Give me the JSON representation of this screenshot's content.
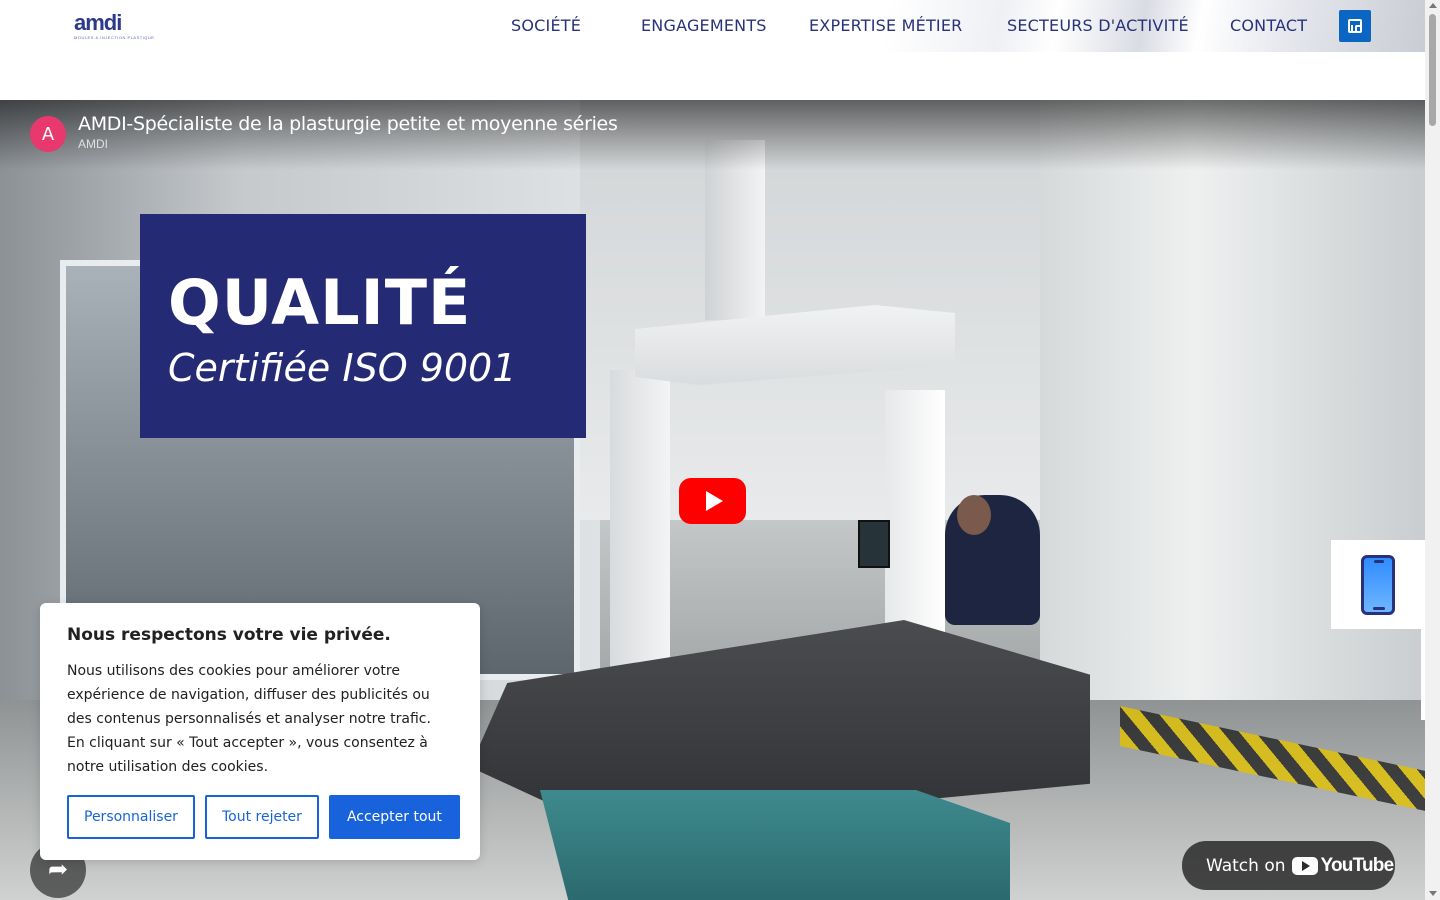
{
  "header": {
    "logo": {
      "wordmark": "amdi",
      "tagline": "MOULES & INJECTION PLASTIQUE"
    },
    "nav": [
      {
        "label": "SOCIÉTÉ"
      },
      {
        "label": "ENGAGEMENTS"
      },
      {
        "label": "EXPERTISE MÉTIER"
      },
      {
        "label": "SECTEURS D'ACTIVITÉ"
      },
      {
        "label": "CONTACT"
      }
    ],
    "social_icon": "linkedin-icon",
    "colors": {
      "nav_text": "#27327a",
      "linkedin_bg": "#0a66c2"
    }
  },
  "video": {
    "channel_initial": "A",
    "title": "AMDI-Spécialiste de la plasturgie petite et moyenne séries",
    "channel": "AMDI",
    "overlay": {
      "headline": "QUALITÉ",
      "subline": "Certifiée ISO 9001"
    },
    "watch_on_label": "Watch on",
    "youtube_wordmark": "YouTube",
    "colors": {
      "play": "#ff0000",
      "card": "#242a73",
      "avatar": "#e8386d"
    }
  },
  "phone_widget": {
    "icon": "smartphone-icon"
  },
  "cookie_banner": {
    "title": "Nous respectons votre vie privée.",
    "text": "Nous utilisons des cookies pour améliorer votre expérience de navigation, diffuser des publicités ou des contenus personnalisés et analyser notre trafic. En cliquant sur « Tout accepter », vous consentez à notre utilisation des cookies.",
    "buttons": {
      "customize": "Personnaliser",
      "reject": "Tout rejeter",
      "accept": "Accepter tout"
    },
    "colors": {
      "primary": "#1863dc"
    }
  }
}
